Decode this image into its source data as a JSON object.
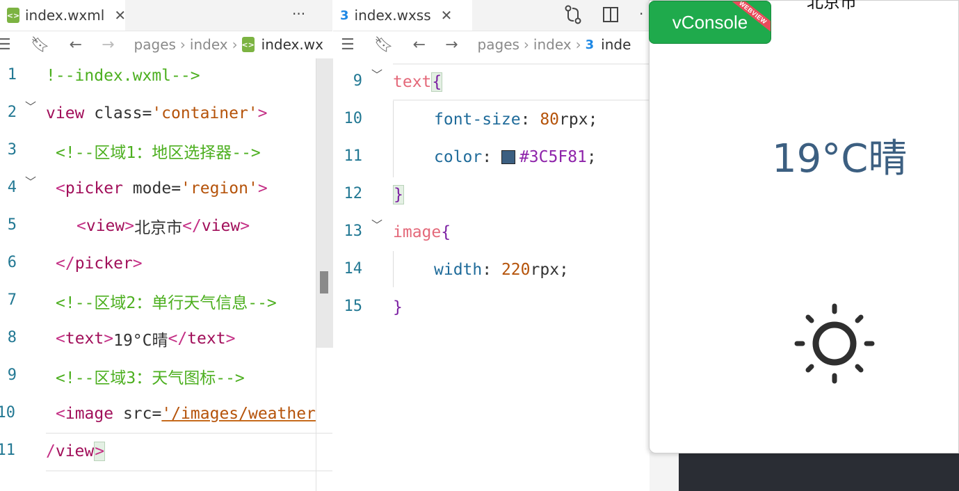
{
  "editor_left": {
    "tab": {
      "label": "index.wxml",
      "close": "✕",
      "more": "···"
    },
    "breadcrumb": {
      "parts": [
        "pages",
        "index"
      ],
      "file": "index.wx"
    },
    "lines": [
      {
        "n": "1",
        "text": "!--index.wxml-->"
      },
      {
        "n": "2",
        "a": "view",
        "b": " class=",
        "c": "'container'",
        "d": ">"
      },
      {
        "n": "3",
        "text": "<!--区域1：地区选择器-->"
      },
      {
        "n": "4",
        "a": "<",
        "b": "picker",
        "c": " mode=",
        "d": "'region'",
        "e": ">"
      },
      {
        "n": "5",
        "a": "<",
        "b": "view",
        "c": ">",
        "d": "北京市",
        "e": "</",
        "f": "view",
        "g": ">"
      },
      {
        "n": "6",
        "a": "</",
        "b": "picker",
        "c": ">"
      },
      {
        "n": "7",
        "text": "<!--区域2：单行天气信息-->"
      },
      {
        "n": "8",
        "a": "<",
        "b": "text",
        "c": ">",
        "d": "19°C晴",
        "e": "</",
        "f": "text",
        "g": ">"
      },
      {
        "n": "9",
        "text": "<!--区域3：天气图标-->"
      },
      {
        "n": "10",
        "a": "<",
        "b": "image",
        "c": " src=",
        "d": "'/images/weather"
      },
      {
        "n": "11",
        "a": "/",
        "b": "view",
        "c": ">"
      }
    ]
  },
  "editor_right": {
    "tab": {
      "label": "index.wxss",
      "close": "✕"
    },
    "breadcrumb": {
      "parts": [
        "pages",
        "index"
      ],
      "file": "inde"
    },
    "lines": [
      {
        "n": "9",
        "sel": "text",
        "brace": "{"
      },
      {
        "n": "10",
        "prop": "font-size",
        "colon": ": ",
        "num": "80",
        "unit": "rpx",
        "semi": ";"
      },
      {
        "n": "11",
        "prop": "color",
        "colon": ": ",
        "val": "#3C5F81",
        "semi": ";",
        "swatch": "#3C5F81"
      },
      {
        "n": "12",
        "brace": "}"
      },
      {
        "n": "13",
        "sel": "image",
        "brace": "{"
      },
      {
        "n": "14",
        "prop": "width",
        "colon": ": ",
        "num": "220",
        "unit": "rpx",
        "semi": ";"
      },
      {
        "n": "15",
        "brace": "}"
      }
    ]
  },
  "simulator": {
    "vconsole": {
      "label": "vConsole",
      "ribbon": "WEBVIEW"
    },
    "top_text": "北京市",
    "weather_text": "19°C晴",
    "weather_color": "#3C5F81",
    "icon": "sun-icon"
  }
}
